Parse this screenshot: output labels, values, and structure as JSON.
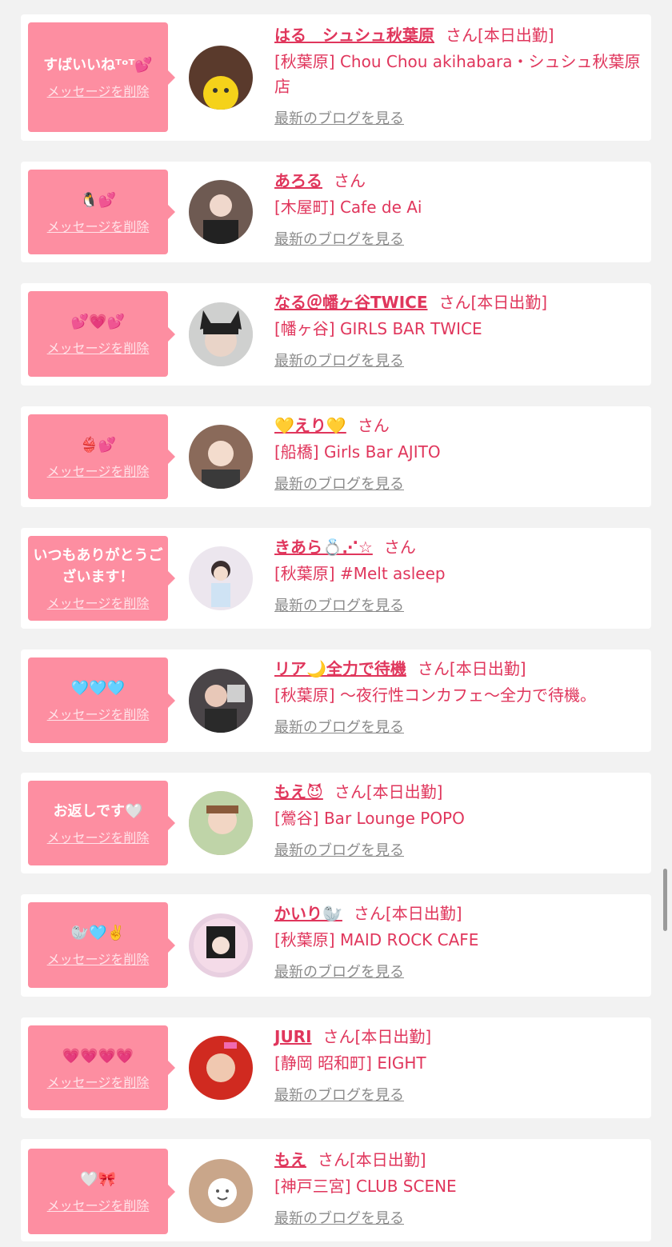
{
  "common": {
    "delete_label": "メッセージを削除",
    "blog_label": "最新のブログを見る"
  },
  "cards": [
    {
      "message": "すばいいねᵀᵒᵀ💕",
      "name": "はる　シュシュ秋葉原",
      "suffix": "さん[本日出勤]",
      "shop": "[秋葉原] Chou Chou akihabara・シュシュ秋葉原店",
      "avatar_color": "#5a3a2c"
    },
    {
      "message": "🐧💕",
      "name": "あろる",
      "suffix": "さん",
      "shop": "[木屋町] Cafe de Ai",
      "avatar_color": "#6e5a52"
    },
    {
      "message": "💕💗💕",
      "name": "なる＠幡ヶ谷TWICE",
      "suffix": "さん[本日出勤]",
      "shop": "[幡ヶ谷] GIRLS BAR TWICE",
      "avatar_color": "#3a3a3a"
    },
    {
      "message": "👙💕",
      "name": "💛えり💛",
      "suffix": "さん",
      "shop": "[船橋] Girls Bar AJITO",
      "avatar_color": "#8a6a5a"
    },
    {
      "message": "いつもありがとうございます！",
      "name": "きあら💍⋰☆",
      "suffix": "さん",
      "shop": "[秋葉原] #Melt asleep",
      "avatar_color": "#e6e0ea"
    },
    {
      "message": "🩵🩵🩵",
      "name": "リア🌙全力で待機",
      "suffix": "さん[本日出勤]",
      "shop": "[秋葉原] ～夜行性コンカフェ～全力で待機。",
      "avatar_color": "#4a4548"
    },
    {
      "message": "お返しです🤍",
      "name": "もえ😈",
      "suffix": "さん[本日出勤]",
      "shop": "[鶯谷] Bar Lounge POPO",
      "avatar_color": "#d8b8a0"
    },
    {
      "message": "🦭🩵✌️",
      "name": "かいり🦭",
      "suffix": "さん[本日出勤]",
      "shop": "[秋葉原] MAID ROCK CAFE",
      "avatar_color": "#e8cfe0"
    },
    {
      "message": "💗💗💗💗",
      "name": "JURI",
      "suffix": "さん[本日出勤]",
      "shop": "[静岡 昭和町] EIGHT",
      "avatar_color": "#d02a20"
    },
    {
      "message": "🤍🎀",
      "name": "もえ",
      "suffix": "さん[本日出勤]",
      "shop": "[神戸三宮] CLUB SCENE",
      "avatar_color": "#c9a68a"
    }
  ]
}
